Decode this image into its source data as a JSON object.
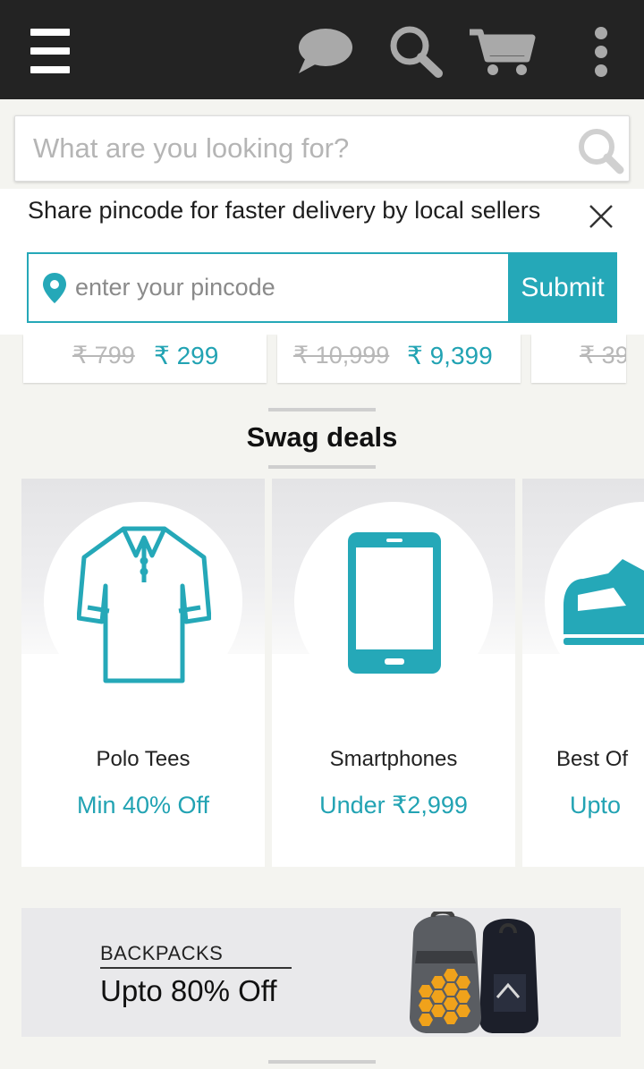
{
  "search": {
    "placeholder": "What are you looking for?"
  },
  "pincode": {
    "message": "Share pincode for faster delivery by local sellers",
    "placeholder": "enter your pincode",
    "submit_label": "Submit"
  },
  "prices": [
    {
      "old": "₹ 799",
      "new": "₹ 299"
    },
    {
      "old": "₹ 10,999",
      "new": "₹ 9,399"
    },
    {
      "old": "₹ 39"
    }
  ],
  "section": {
    "title": "Swag deals"
  },
  "deals": [
    {
      "name": "Polo Tees",
      "offer": "Min 40% Off",
      "icon": "polo-shirt-icon"
    },
    {
      "name": "Smartphones",
      "offer": "Under ₹2,999",
      "icon": "smartphone-icon"
    },
    {
      "name": "Best Of",
      "offer": "Upto",
      "icon": "shoe-icon"
    }
  ],
  "banner": {
    "kicker": "BACKPACKS",
    "headline": "Upto 80% Off",
    "icon": "backpack-icon"
  },
  "colors": {
    "topbar": "#232323",
    "accent": "#25a8b8",
    "page_bg": "#f4f4f0"
  }
}
